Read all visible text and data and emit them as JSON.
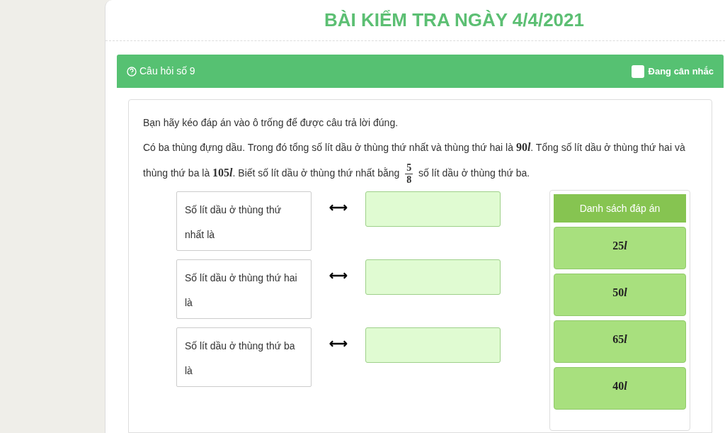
{
  "page_title": "BÀI KIỂM TRA NGÀY 4/4/2021",
  "question": {
    "title": "Câu hỏi số 9",
    "flag": {
      "label": "Đang cân nhắc",
      "checked": false
    },
    "instruction": "Bạn hãy kéo đáp án vào ô trống để được câu trả lời đúng.",
    "problem": [
      {
        "kind": "text",
        "text": "Có ba thùng đựng dầu. Trong đó tổng số lít dầu ở thùng thứ nhất và thùng thứ hai là "
      },
      {
        "kind": "quantity",
        "number": "90",
        "unit": "l"
      },
      {
        "kind": "text",
        "text": ". Tổng số lít dầu ở thùng thứ hai và thùng thứ ba là "
      },
      {
        "kind": "quantity",
        "number": "105",
        "unit": "l"
      },
      {
        "kind": "text",
        "text": ". Biết số lít dầu ở thùng thứ nhất bằng "
      },
      {
        "kind": "fraction",
        "numerator": "5",
        "denominator": "8"
      },
      {
        "kind": "text",
        "text": " số lít dầu ở thùng thứ ba."
      }
    ],
    "pairs": [
      {
        "label": "Số lít dầu ở thùng thứ nhất là",
        "arrow": "⟷"
      },
      {
        "label": "Số lít dầu ở thùng thứ hai là",
        "arrow": "⟷"
      },
      {
        "label": "Số lít dầu ở thùng thứ ba là",
        "arrow": "⟷"
      }
    ],
    "answers_title": "Danh sách đáp án",
    "answers": [
      {
        "number": "25",
        "unit": "l"
      },
      {
        "number": "50",
        "unit": "l"
      },
      {
        "number": "65",
        "unit": "l"
      },
      {
        "number": "40",
        "unit": "l"
      }
    ]
  }
}
